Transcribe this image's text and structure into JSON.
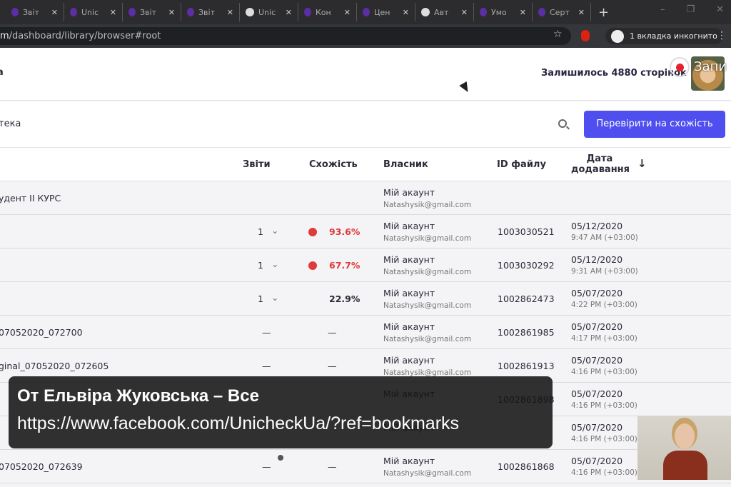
{
  "browser": {
    "tabs": [
      {
        "label": "Звіт",
        "icon": "unicheck-favicon"
      },
      {
        "label": "Unic",
        "icon": "unicheck-favicon"
      },
      {
        "label": "Звіт",
        "icon": "unicheck-favicon"
      },
      {
        "label": "Звіт",
        "icon": "unicheck-favicon"
      },
      {
        "label": "Unic",
        "icon": "globe-icon"
      },
      {
        "label": "Кон",
        "icon": "unicheck-favicon"
      },
      {
        "label": "Цен",
        "icon": "unicheck-favicon"
      },
      {
        "label": "Авт",
        "icon": "globe-icon"
      },
      {
        "label": "Умо",
        "icon": "unicheck-favicon"
      },
      {
        "label": "Серт",
        "icon": "unicheck-favicon"
      }
    ],
    "url_host": "m",
    "url_path": "/dashboard/library/browser#root",
    "incognito": "1 вкладка инкогнито"
  },
  "header": {
    "left": "a",
    "pages_left": "Залишилось 4880 сторінок",
    "recording_label": "Запи"
  },
  "toolbar": {
    "title": "тека",
    "check_button": "Перевірити на схожість"
  },
  "table": {
    "columns": {
      "reports": "Звіти",
      "similarity": "Схожість",
      "owner": "Власник",
      "file_id": "ID файлу",
      "date": "Дата додавання"
    },
    "rows": [
      {
        "name": "удент ІІ КУРС",
        "owner": "Мій акаунт",
        "email": "Natashysik@gmail.com"
      },
      {
        "name": "",
        "reports": "1",
        "similarity": "93.6%",
        "alert": true,
        "owner": "Мій акаунт",
        "email": "Natashysik@gmail.com",
        "id": "1003030521",
        "date": "05/12/2020",
        "time": "9:47 AM (+03:00)"
      },
      {
        "name": "",
        "reports": "1",
        "similarity": "67.7%",
        "alert": true,
        "owner": "Мій акаунт",
        "email": "Natashysik@gmail.com",
        "id": "1003030292",
        "date": "05/12/2020",
        "time": "9:31 AM (+03:00)"
      },
      {
        "name": "",
        "reports": "1",
        "similarity": "22.9%",
        "alert": false,
        "owner": "Мій акаунт",
        "email": "Natashysik@gmail.com",
        "id": "1002862473",
        "date": "05/07/2020",
        "time": "4:22 PM (+03:00)"
      },
      {
        "name": "07052020_072700",
        "dash": "—",
        "owner": "Мій акаунт",
        "email": "Natashysik@gmail.com",
        "id": "1002861985",
        "date": "05/07/2020",
        "time": "4:17 PM (+03:00)"
      },
      {
        "name": "ginal_07052020_072605",
        "dash": "—",
        "owner": "Мій акаунт",
        "email": "Natashysik@gmail.com",
        "id": "1002861913",
        "date": "05/07/2020",
        "time": "4:16 PM (+03:00)"
      },
      {
        "name": "",
        "owner": "Мій акаунт",
        "email": "",
        "id": "1002861898",
        "date": "05/07/2020",
        "time": "4:16 PM (+03:00)"
      },
      {
        "name": "",
        "owner": "Мій акаунт",
        "email": "",
        "id": "",
        "date": "05/07/2020",
        "time": "4:16 PM (+03:00)"
      },
      {
        "name": "07052020_072639",
        "dash": "—",
        "owner": "Мій акаунт",
        "email": "Natashysik@gmail.com",
        "id": "1002861868",
        "date": "05/07/2020",
        "time": "4:16 PM (+03:00)"
      }
    ]
  },
  "caption": {
    "line1": "От Ельвіра Жуковська – Все",
    "line2": "https://www.facebook.com/UnicheckUa/?ref=bookmarks"
  },
  "colors": {
    "accent": "#4f4ff0",
    "alert": "#e03a3a"
  }
}
